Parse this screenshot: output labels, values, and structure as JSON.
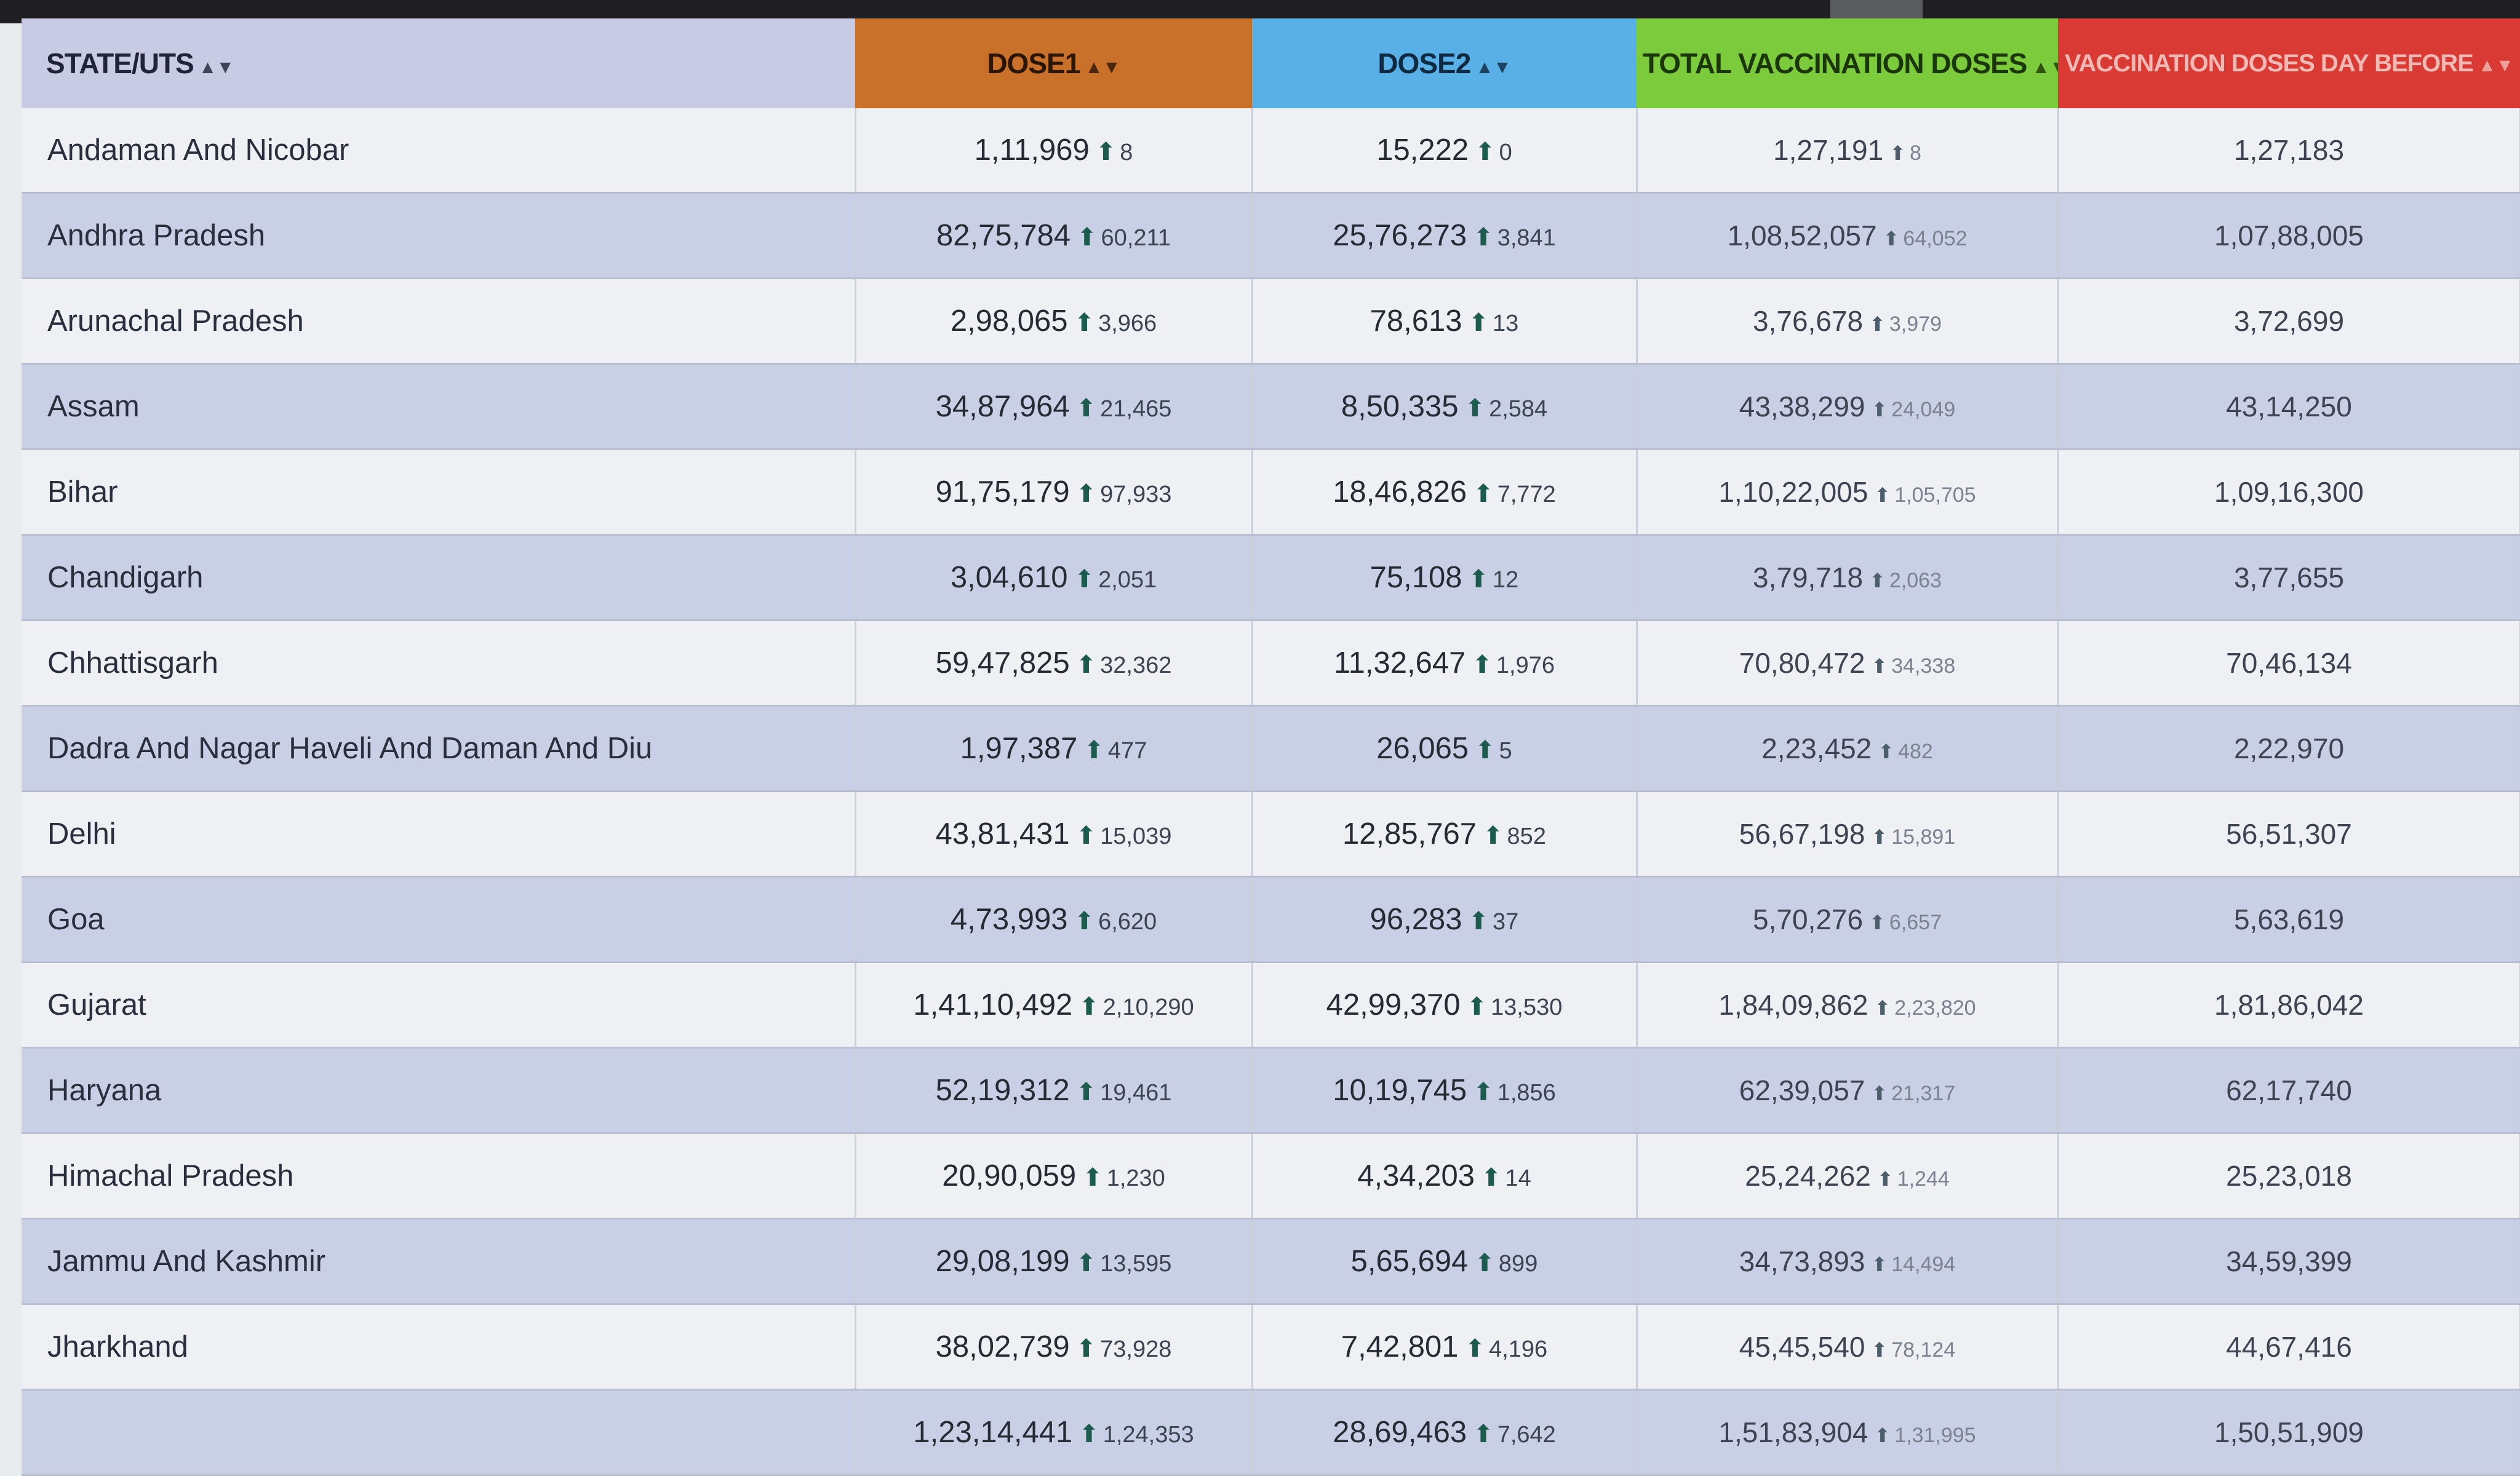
{
  "headers": {
    "state": "STATE/UTS",
    "dose1": "DOSE1",
    "dose2": "DOSE2",
    "total": "TOTAL VACCINATION DOSES",
    "previous": "VACCINATION DOSES DAY BEFORE"
  },
  "icons": {
    "sort": "sort-icon",
    "increase": "arrow-up-icon"
  },
  "rows": [
    {
      "state": "Andaman And Nicobar",
      "dose1": "1,11,969",
      "dose1_delta": "8",
      "dose2": "15,222",
      "dose2_delta": "0",
      "total": "1,27,191",
      "total_delta": "8",
      "previous": "1,27,183"
    },
    {
      "state": "Andhra Pradesh",
      "dose1": "82,75,784",
      "dose1_delta": "60,211",
      "dose2": "25,76,273",
      "dose2_delta": "3,841",
      "total": "1,08,52,057",
      "total_delta": "64,052",
      "previous": "1,07,88,005"
    },
    {
      "state": "Arunachal Pradesh",
      "dose1": "2,98,065",
      "dose1_delta": "3,966",
      "dose2": "78,613",
      "dose2_delta": "13",
      "total": "3,76,678",
      "total_delta": "3,979",
      "previous": "3,72,699"
    },
    {
      "state": "Assam",
      "dose1": "34,87,964",
      "dose1_delta": "21,465",
      "dose2": "8,50,335",
      "dose2_delta": "2,584",
      "total": "43,38,299",
      "total_delta": "24,049",
      "previous": "43,14,250"
    },
    {
      "state": "Bihar",
      "dose1": "91,75,179",
      "dose1_delta": "97,933",
      "dose2": "18,46,826",
      "dose2_delta": "7,772",
      "total": "1,10,22,005",
      "total_delta": "1,05,705",
      "previous": "1,09,16,300"
    },
    {
      "state": "Chandigarh",
      "dose1": "3,04,610",
      "dose1_delta": "2,051",
      "dose2": "75,108",
      "dose2_delta": "12",
      "total": "3,79,718",
      "total_delta": "2,063",
      "previous": "3,77,655"
    },
    {
      "state": "Chhattisgarh",
      "dose1": "59,47,825",
      "dose1_delta": "32,362",
      "dose2": "11,32,647",
      "dose2_delta": "1,976",
      "total": "70,80,472",
      "total_delta": "34,338",
      "previous": "70,46,134"
    },
    {
      "state": "Dadra And Nagar Haveli And Daman And Diu",
      "dose1": "1,97,387",
      "dose1_delta": "477",
      "dose2": "26,065",
      "dose2_delta": "5",
      "total": "2,23,452",
      "total_delta": "482",
      "previous": "2,22,970"
    },
    {
      "state": "Delhi",
      "dose1": "43,81,431",
      "dose1_delta": "15,039",
      "dose2": "12,85,767",
      "dose2_delta": "852",
      "total": "56,67,198",
      "total_delta": "15,891",
      "previous": "56,51,307"
    },
    {
      "state": "Goa",
      "dose1": "4,73,993",
      "dose1_delta": "6,620",
      "dose2": "96,283",
      "dose2_delta": "37",
      "total": "5,70,276",
      "total_delta": "6,657",
      "previous": "5,63,619"
    },
    {
      "state": "Gujarat",
      "dose1": "1,41,10,492",
      "dose1_delta": "2,10,290",
      "dose2": "42,99,370",
      "dose2_delta": "13,530",
      "total": "1,84,09,862",
      "total_delta": "2,23,820",
      "previous": "1,81,86,042"
    },
    {
      "state": "Haryana",
      "dose1": "52,19,312",
      "dose1_delta": "19,461",
      "dose2": "10,19,745",
      "dose2_delta": "1,856",
      "total": "62,39,057",
      "total_delta": "21,317",
      "previous": "62,17,740"
    },
    {
      "state": "Himachal Pradesh",
      "dose1": "20,90,059",
      "dose1_delta": "1,230",
      "dose2": "4,34,203",
      "dose2_delta": "14",
      "total": "25,24,262",
      "total_delta": "1,244",
      "previous": "25,23,018"
    },
    {
      "state": "Jammu And Kashmir",
      "dose1": "29,08,199",
      "dose1_delta": "13,595",
      "dose2": "5,65,694",
      "dose2_delta": "899",
      "total": "34,73,893",
      "total_delta": "14,494",
      "previous": "34,59,399"
    },
    {
      "state": "Jharkhand",
      "dose1": "38,02,739",
      "dose1_delta": "73,928",
      "dose2": "7,42,801",
      "dose2_delta": "4,196",
      "total": "45,45,540",
      "total_delta": "78,124",
      "previous": "44,67,416"
    },
    {
      "state": "",
      "dose1": "1,23,14,441",
      "dose1_delta": "1,24,353",
      "dose2": "28,69,463",
      "dose2_delta": "7,642",
      "total": "1,51,83,904",
      "total_delta": "1,31,995",
      "previous": "1,50,51,909"
    }
  ]
}
